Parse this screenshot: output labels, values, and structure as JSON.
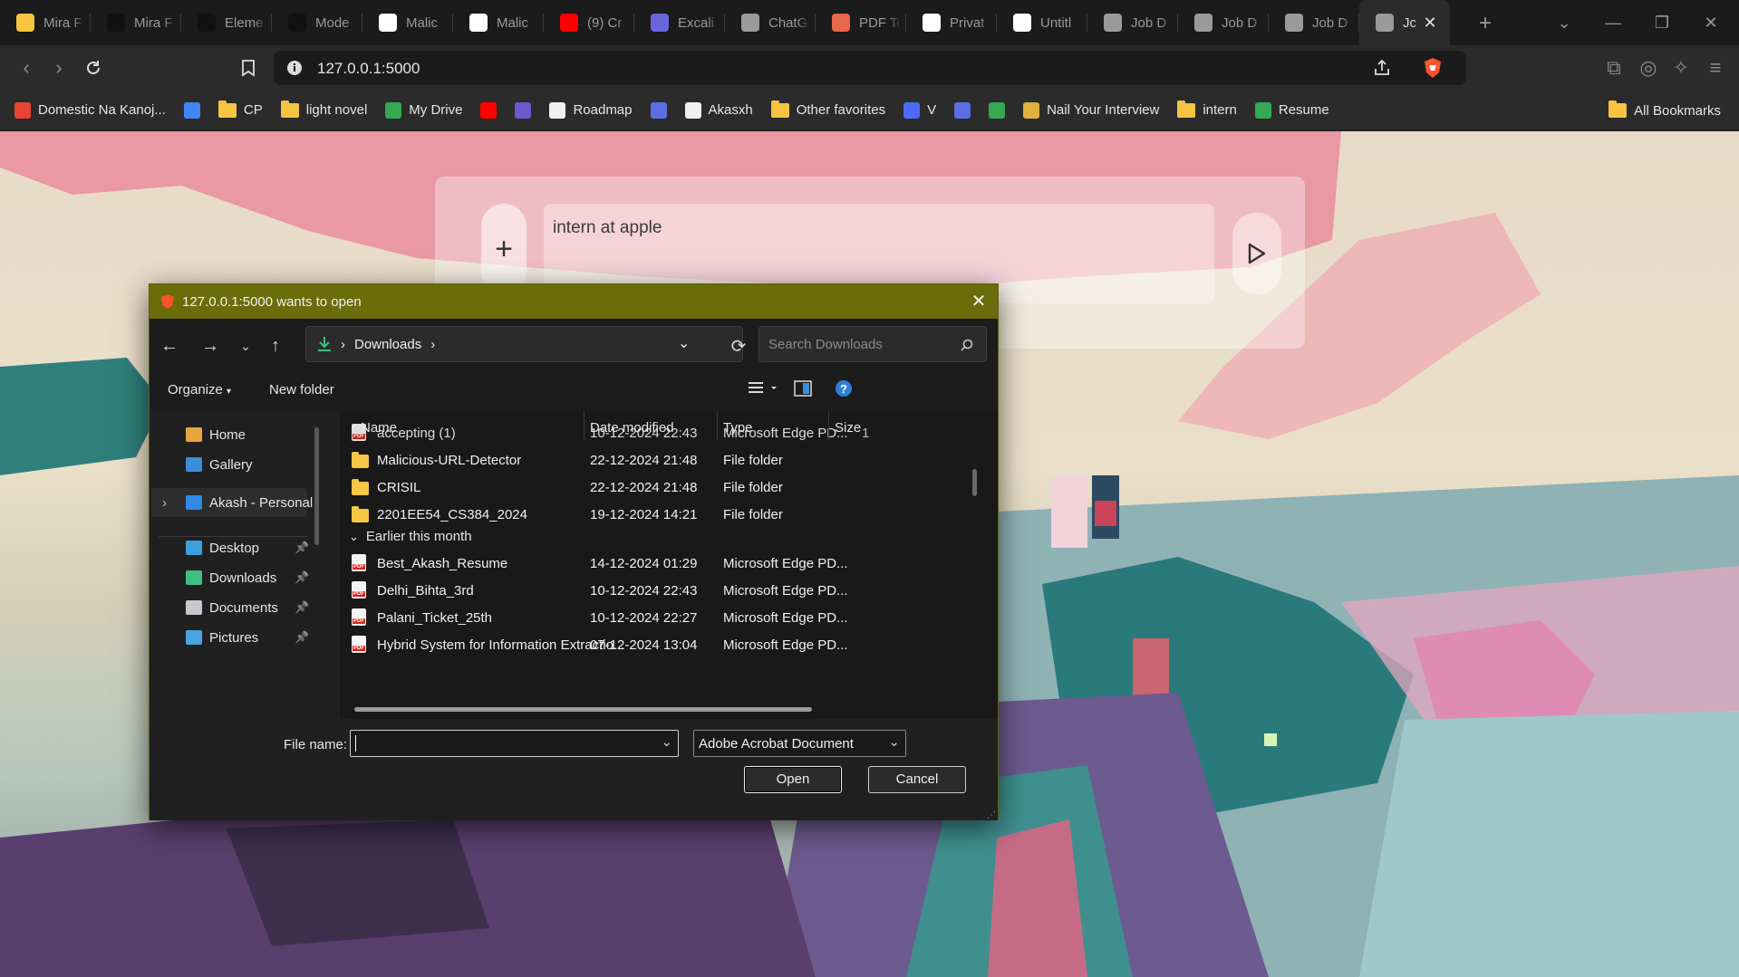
{
  "browser": {
    "tabs": [
      {
        "title": "Mira F",
        "icon": "folder-icon",
        "color": "#f5c542"
      },
      {
        "title": "Mira F",
        "icon": "app-icon",
        "color": "#111111"
      },
      {
        "title": "Eleme",
        "icon": "app-icon",
        "color": "#111111"
      },
      {
        "title": "Mode",
        "icon": "app-icon",
        "color": "#111111"
      },
      {
        "title": "Malic",
        "icon": "github-icon",
        "color": "#ffffff"
      },
      {
        "title": "Malic",
        "icon": "github-icon",
        "color": "#ffffff"
      },
      {
        "title": "(9) Cr",
        "icon": "youtube-icon",
        "color": "#ff0000"
      },
      {
        "title": "Excali",
        "icon": "excalidraw-icon",
        "color": "#6965db"
      },
      {
        "title": "ChatG",
        "icon": "chatgpt-icon",
        "color": "#9a9a9a"
      },
      {
        "title": "PDF Tc",
        "icon": "pdf-tool-icon",
        "color": "#e8664a"
      },
      {
        "title": "Privat",
        "icon": "app-icon",
        "color": "#ffffff"
      },
      {
        "title": "Untitl",
        "icon": "app-icon",
        "color": "#ffffff"
      },
      {
        "title": "Job D",
        "icon": "globe-icon",
        "color": "#9a9a9a"
      },
      {
        "title": "Job D",
        "icon": "globe-icon",
        "color": "#9a9a9a"
      },
      {
        "title": "Job D",
        "icon": "globe-icon",
        "color": "#9a9a9a"
      },
      {
        "title": "Jc",
        "icon": "globe-icon",
        "color": "#9a9a9a"
      }
    ],
    "url": "127.0.0.1:5000",
    "bookmarks": [
      {
        "label": "Domestic Na Kanoj...",
        "kind": "gmail-icon",
        "color": "#ea4335"
      },
      {
        "label": "",
        "kind": "docs-icon",
        "color": "#4285f4"
      },
      {
        "label": "CP",
        "kind": "folder"
      },
      {
        "label": "light novel",
        "kind": "folder"
      },
      {
        "label": "My Drive",
        "kind": "drive-icon",
        "color": "#34a853"
      },
      {
        "label": "",
        "kind": "youtube-icon",
        "color": "#ff0000"
      },
      {
        "label": "",
        "kind": "app-icon",
        "color": "#6a5acd"
      },
      {
        "label": "Roadmap",
        "kind": "rocket-icon",
        "color": "#f0f0f0"
      },
      {
        "label": "",
        "kind": "code-icon",
        "color": "#5b6ee1"
      },
      {
        "label": "Akasxh",
        "kind": "github-icon",
        "color": "#f0f0f0"
      },
      {
        "label": "Other favorites",
        "kind": "folder"
      },
      {
        "label": "V",
        "kind": "app-icon",
        "color": "#4a6cf7"
      },
      {
        "label": "",
        "kind": "code-icon",
        "color": "#5b6ee1"
      },
      {
        "label": "",
        "kind": "app-icon",
        "color": "#34a853"
      },
      {
        "label": "Nail Your Interview",
        "kind": "app-icon",
        "color": "#e0b040"
      },
      {
        "label": "intern",
        "kind": "folder"
      },
      {
        "label": "Resume",
        "kind": "drive-icon",
        "color": "#34a853"
      }
    ],
    "all_bookmarks": "All Bookmarks"
  },
  "page": {
    "chat_text": "intern at apple"
  },
  "dialog": {
    "title": "127.0.0.1:5000 wants to open",
    "path_folder": "Downloads",
    "search_placeholder": "Search Downloads",
    "organize": "Organize",
    "new_folder": "New folder",
    "sidebar": [
      {
        "label": "Home",
        "icon": "home-icon",
        "top": 0
      },
      {
        "label": "Gallery",
        "icon": "gallery-icon"
      },
      {
        "label": "Akash - Personal",
        "icon": "onedrive-icon"
      },
      {
        "label": "Desktop",
        "icon": "desktop-icon"
      },
      {
        "label": "Downloads",
        "icon": "download-icon"
      },
      {
        "label": "Documents",
        "icon": "documents-icon"
      },
      {
        "label": "Pictures",
        "icon": "pictures-icon"
      }
    ],
    "columns": {
      "name": "Name",
      "date": "Date modified",
      "type": "Type",
      "size": "Size"
    },
    "partial_row": {
      "name": "accepting (1)",
      "date": "10-12-2024 22:43",
      "type": "Microsoft Edge PD...",
      "size": "1"
    },
    "files_recent": [
      {
        "name": "Malicious-URL-Detector",
        "date": "22-12-2024 21:48",
        "type": "File folder",
        "kind": "folder"
      },
      {
        "name": "CRISIL",
        "date": "22-12-2024 21:48",
        "type": "File folder",
        "kind": "folder"
      },
      {
        "name": "2201EE54_CS384_2024",
        "date": "19-12-2024 14:21",
        "type": "File folder",
        "kind": "folder"
      }
    ],
    "group_label": "Earlier this month",
    "files_earlier": [
      {
        "name": "Best_Akash_Resume",
        "date": "14-12-2024 01:29",
        "type": "Microsoft Edge PD...",
        "kind": "pdf"
      },
      {
        "name": "Delhi_Bihta_3rd",
        "date": "10-12-2024 22:43",
        "type": "Microsoft Edge PD...",
        "kind": "pdf"
      },
      {
        "name": "Palani_Ticket_25th",
        "date": "10-12-2024 22:27",
        "type": "Microsoft Edge PD...",
        "kind": "pdf"
      },
      {
        "name": "Hybrid System for Information Extractio...",
        "date": "07-12-2024 13:04",
        "type": "Microsoft Edge PD...",
        "kind": "pdf"
      }
    ],
    "file_name_label": "File name:",
    "file_name_value": "",
    "file_type": "Adobe Acrobat Document",
    "open_label": "Open",
    "cancel_label": "Cancel"
  }
}
